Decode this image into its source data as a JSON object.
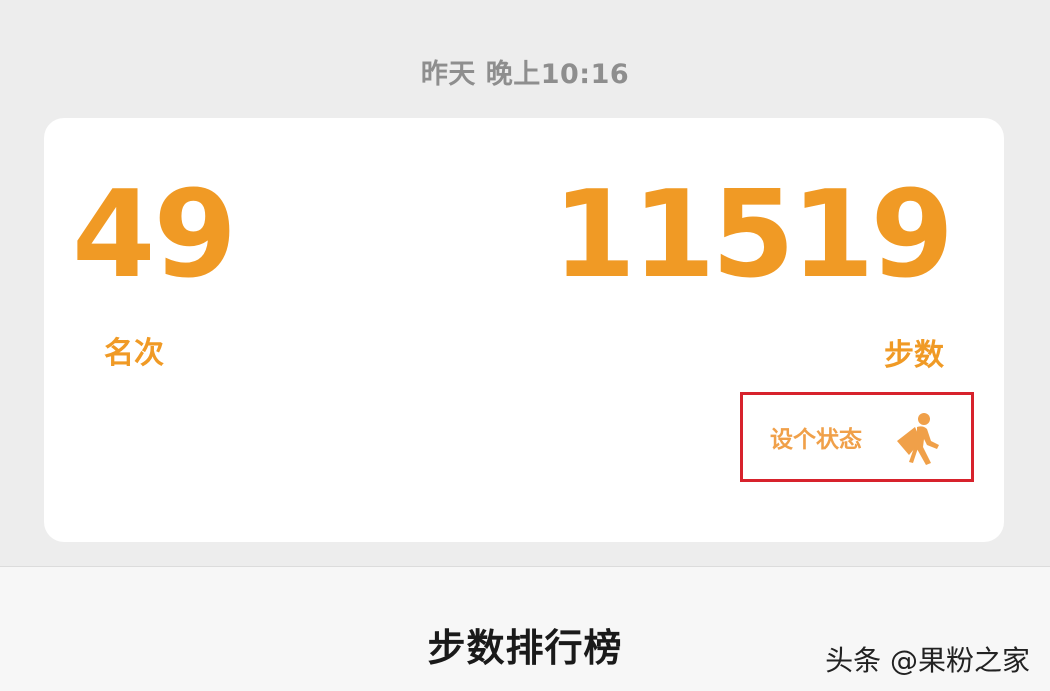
{
  "header": {
    "timestamp": "昨天 晚上10:16"
  },
  "card": {
    "rank": {
      "value": "49",
      "label": "名次"
    },
    "steps": {
      "value": "11519",
      "label": "步数"
    },
    "status_button": {
      "label": "设个状态",
      "icon": "walking-person-icon"
    }
  },
  "footer": {
    "title": "步数排行榜",
    "watermark": "头条 @果粉之家"
  },
  "colors": {
    "accent": "#f09a25",
    "highlight_border": "#d7222c",
    "background": "#ededed",
    "card": "#ffffff"
  }
}
